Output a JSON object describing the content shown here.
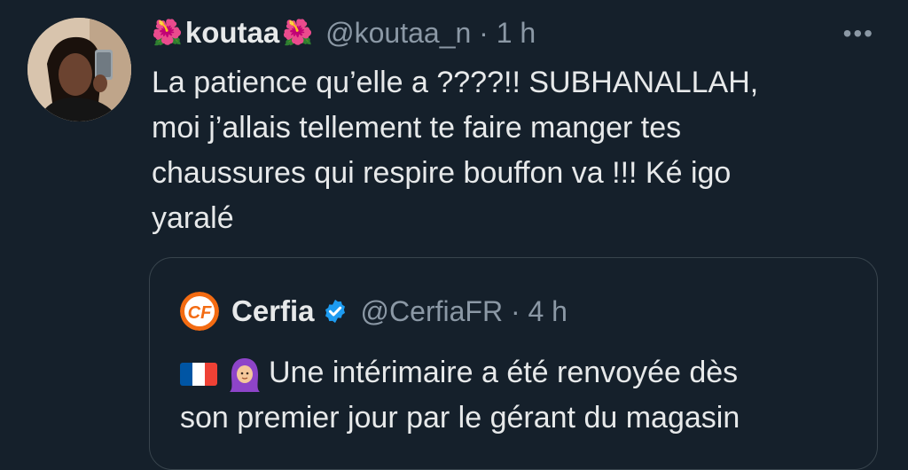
{
  "tweet": {
    "author": {
      "flower_emoji": "🌺",
      "display_name": "koutaa",
      "handle": "@koutaa_n",
      "time": "1 h"
    },
    "more_icon": "more-dots-icon",
    "text": "La patience qu’elle a ????!!  SUBHANALLAH,\nmoi j’allais tellement te faire manger tes\nchaussures qui respire bouffon va !!! Ké igo\nyaralé"
  },
  "quote": {
    "author": {
      "display_name": "Cerfia",
      "handle": "@CerfiaFR",
      "time": "4 h",
      "verified": true
    },
    "text": "Une intérimaire a été renvoyée dès\nson premier jour par le gérant du magasin"
  },
  "colors": {
    "background": "#15202b",
    "text": "#e7e9ea",
    "secondary": "#8b98a5",
    "verified": "#1d9bf0",
    "border": "#38444d"
  }
}
